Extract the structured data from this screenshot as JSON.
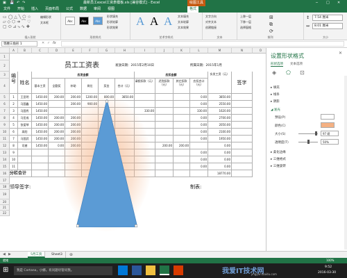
{
  "window": {
    "title": "最新员工excel工资表模板.xls [兼容模式] - Excel",
    "tool_context": "绘图工具"
  },
  "tabs": [
    "文件",
    "开始",
    "插入",
    "页面布局",
    "公式",
    "数据",
    "审阅",
    "视图",
    "格式"
  ],
  "ribbon": {
    "groups": [
      "插入形状",
      "形状样式",
      "艺术字样式",
      "文本",
      "排列",
      "大小"
    ],
    "edit_shape": "编辑形状",
    "text_box": "文本框",
    "style_swatches": [
      "Abc",
      "Abc",
      "Abc"
    ],
    "shape_fill": "形状填充",
    "shape_outline": "形状轮廓",
    "shape_effect": "形状效果",
    "wordart_letters": [
      "A",
      "A",
      "A"
    ],
    "text_fill": "文本填充",
    "text_outline": "文本轮廓",
    "text_effect": "文本效果",
    "text_direction": "文字方向",
    "align_text": "对齐文本",
    "create_link": "创建链接",
    "bring_forward": "上移一层",
    "send_backward": "下移一层",
    "selection_pane": "选择窗格",
    "height": "7.54 厘米",
    "width": "8.01 厘米"
  },
  "formula_bar": {
    "name_box": "等腰三角形 1",
    "fx": "fx"
  },
  "columns": [
    "A",
    "B",
    "C",
    "D",
    "E",
    "F",
    "G",
    "H",
    "I",
    "J",
    "K",
    "L",
    "M",
    "N",
    "O"
  ],
  "rows": [
    "1",
    "2",
    "3",
    "4",
    "5",
    "6",
    "7",
    "8",
    "9",
    "10",
    "11",
    "12",
    "13",
    "14",
    "15",
    "16",
    "17",
    "18",
    "19",
    "20",
    "21",
    "22"
  ],
  "sheet": {
    "title": "员工工资表",
    "issue_date_label": "发放日期：2015年2月10日",
    "period_label": "所属日期：2015年1月",
    "hdr_no": "编号",
    "hdr_name": "姓名",
    "hdr_payable": "应发金额",
    "hdr_deduct": "应扣金额",
    "hdr_actual": "实发工资（元）",
    "hdr_sign": "签字",
    "sub_payable": [
      "基本工资",
      "全勤奖",
      "补助",
      "岗位",
      "奖金",
      "合计（元）"
    ],
    "sub_deduct": [
      "请假扣款（元）",
      "迟到扣款（元）",
      "其它扣款（元）",
      "应扣合计（元）"
    ],
    "rows": [
      {
        "no": "1",
        "name": "王亚明",
        "vals": [
          "1450.00",
          "200.00",
          "200.00",
          "1200.00",
          "800.00",
          "3850.00",
          "",
          "",
          "",
          "0.00",
          "3850.00"
        ]
      },
      {
        "no": "2",
        "name": "马国鑫",
        "vals": [
          "1450.00",
          "",
          "200.00",
          "900.00",
          "",
          "",
          "",
          "",
          "",
          "0.00",
          "2550.00"
        ]
      },
      {
        "no": "3",
        "name": "马国秀",
        "vals": [
          "1450.00",
          "",
          "",
          "",
          "",
          "",
          "330.00",
          "",
          "",
          "330.00",
          "1620.00"
        ]
      },
      {
        "no": "4",
        "name": "马亚成",
        "vals": [
          "1450.00",
          "200.00",
          "200.00",
          "",
          "",
          "",
          "",
          "",
          "",
          "0.00",
          "2700.00"
        ]
      },
      {
        "no": "5",
        "name": "张爱琴",
        "vals": [
          "1450.00",
          "200.00",
          "200.00",
          "",
          "",
          "",
          "",
          "",
          "",
          "0.00",
          "2050.00"
        ]
      },
      {
        "no": "6",
        "name": "高阳",
        "vals": [
          "1450.00",
          "200.00",
          "200.00",
          "",
          "",
          "",
          "",
          "",
          "",
          "0.00",
          "2100.00"
        ]
      },
      {
        "no": "7",
        "name": "马国武",
        "vals": [
          "1450.00",
          "200.00",
          "200.00",
          "",
          "",
          "",
          "",
          "",
          "",
          "0.00",
          "1950.00"
        ]
      },
      {
        "no": "8",
        "name": "司睿",
        "vals": [
          "1450.00",
          "0.00",
          "200.00",
          "",
          "",
          "",
          "",
          "200.00",
          "200.00",
          "",
          "0.00"
        ]
      },
      {
        "no": "9",
        "name": "",
        "vals": [
          "",
          "",
          "",
          "",
          "",
          "",
          "",
          "",
          "",
          "0.00",
          "0.00"
        ]
      },
      {
        "no": "10",
        "name": "",
        "vals": [
          "",
          "",
          "",
          "",
          "",
          "",
          "",
          "",
          "",
          "0.00",
          "0.00"
        ]
      },
      {
        "no": "11",
        "name": "",
        "vals": [
          "",
          "",
          "",
          "",
          "",
          "",
          "",
          "",
          "",
          "0.00",
          "0.00"
        ]
      }
    ],
    "subtotal_label": "分栏合计",
    "subtotal_value": "18770.00",
    "leader_sign": "领导签字:",
    "cashier": "出纳:",
    "preparer": "制表:"
  },
  "pane": {
    "title": "设置形状格式",
    "tab_shape": "形状选项",
    "tab_text": "文本选项",
    "sections": [
      "填充",
      "线条",
      "阴影",
      "预设(P)",
      "颜色(C)",
      "大小(S)",
      "透明度(T)",
      "柔化边缘",
      "三维格式",
      "三维旋转"
    ],
    "size_value": "97 磅",
    "transparency_value": "50%"
  },
  "sheet_tabs": [
    "5月工资",
    "Sheet3"
  ],
  "status": {
    "ready": "就绪",
    "zoom": "100%"
  },
  "taskbar": {
    "search": "我是 Cortana，小娜。有问题尽管问我。",
    "time": "9:52",
    "date": "2016-03-30"
  },
  "watermark": "jingyan.baidu.com",
  "colors": {
    "excel_green": "#217346",
    "shape_blue": "#5b9bd5",
    "glow_orange": "#f4b183",
    "context_orange": "#c55a11"
  }
}
